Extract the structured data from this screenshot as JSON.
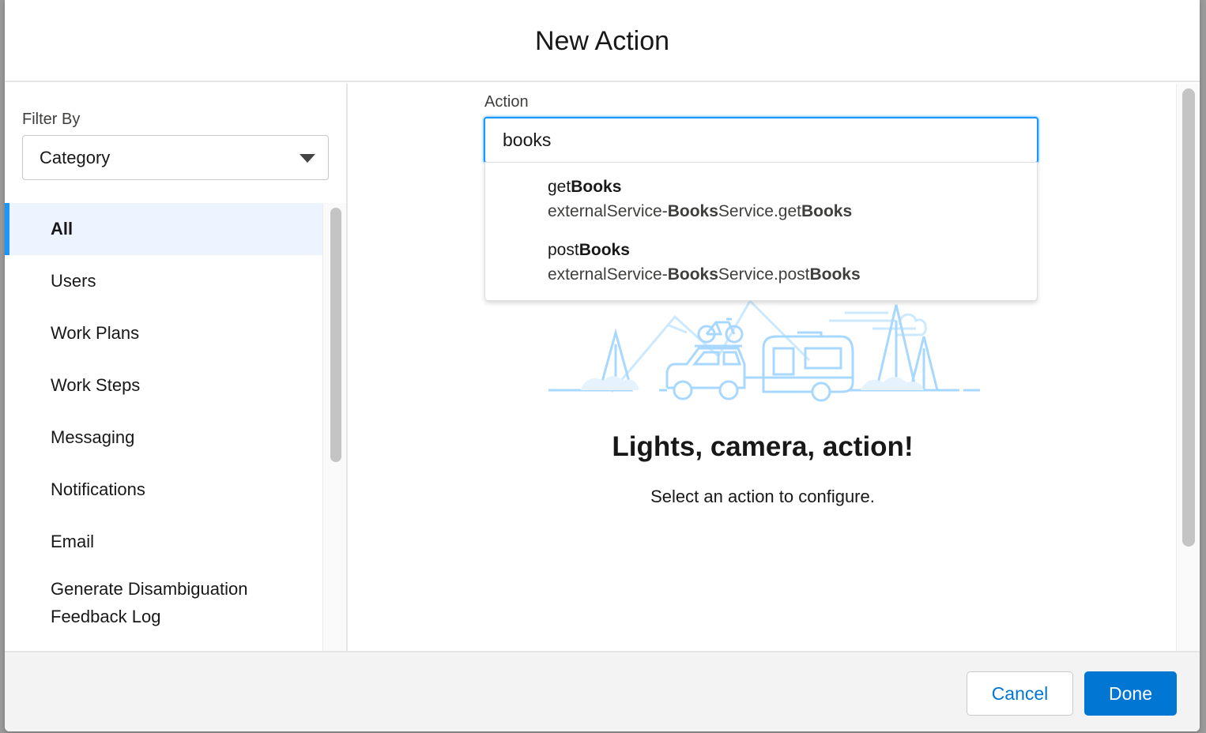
{
  "modal": {
    "title": "New Action"
  },
  "sidebar": {
    "filter_label": "Filter By",
    "filter_value": "Category",
    "categories": [
      {
        "label": "All",
        "active": true
      },
      {
        "label": "Users"
      },
      {
        "label": "Work Plans"
      },
      {
        "label": "Work Steps"
      },
      {
        "label": "Messaging"
      },
      {
        "label": "Notifications"
      },
      {
        "label": "Email"
      },
      {
        "label": "Generate Disambiguation Feedback Log"
      }
    ]
  },
  "main": {
    "action_label": "Action",
    "action_value": "books",
    "suggestions": [
      {
        "title_pre": "get",
        "title_match": "Books",
        "sub_1": "externalService-",
        "sub_match_1": "Books",
        "sub_2": "Service.get",
        "sub_match_2": "Books"
      },
      {
        "title_pre": "post",
        "title_match": "Books",
        "sub_1": "externalService-",
        "sub_match_1": "Books",
        "sub_2": "Service.post",
        "sub_match_2": "Books"
      }
    ],
    "empty_state": {
      "title": "Lights, camera, action!",
      "subtitle": "Select an action to configure."
    }
  },
  "footer": {
    "cancel_label": "Cancel",
    "done_label": "Done"
  },
  "colors": {
    "brand": "#0176d3",
    "focus": "#1b96ff",
    "active_bg": "#eef4ff",
    "illustration": "#a8d8ff"
  }
}
